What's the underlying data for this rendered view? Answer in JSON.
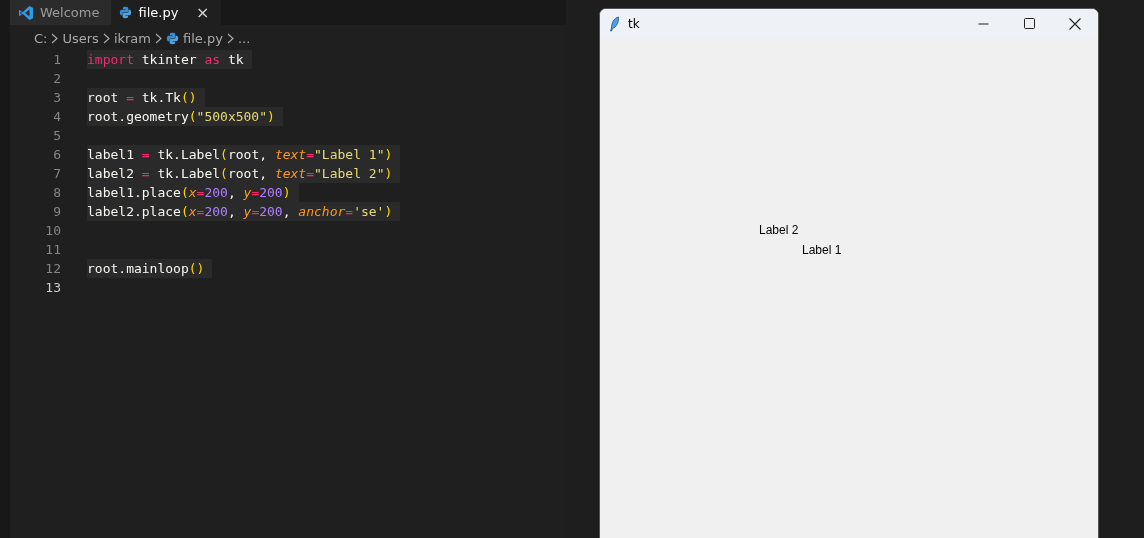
{
  "tabs": [
    {
      "label": "Welcome",
      "kind": "welcome",
      "selected": false
    },
    {
      "label": "file.py",
      "kind": "file",
      "selected": true,
      "close_glyph": "×"
    }
  ],
  "breadcrumb": [
    {
      "label": "C:",
      "kind": "folder"
    },
    {
      "label": "Users",
      "kind": "folder"
    },
    {
      "label": "ikram",
      "kind": "folder"
    },
    {
      "label": "file.py",
      "kind": "file"
    },
    {
      "label": "...",
      "kind": "more"
    }
  ],
  "code": [
    {
      "number": "1",
      "tokens": [
        {
          "kind": "keyword",
          "text": "import"
        },
        {
          "kind": "plain",
          "text": " tkinter "
        },
        {
          "kind": "keyword",
          "text": "as"
        },
        {
          "kind": "plain",
          "text": " tk"
        }
      ]
    },
    {
      "number": "2"
    },
    {
      "number": "3",
      "tokens": [
        {
          "kind": "plain",
          "text": "root "
        },
        {
          "kind": "operator",
          "text": "="
        },
        {
          "kind": "plain",
          "text": " tk.Tk"
        },
        {
          "kind": "paren",
          "text": "()"
        }
      ]
    },
    {
      "number": "4",
      "tokens": [
        {
          "kind": "plain",
          "text": "root.geometry"
        },
        {
          "kind": "paren",
          "text": "("
        },
        {
          "kind": "string",
          "text": "\"500x500\""
        },
        {
          "kind": "paren",
          "text": ")"
        }
      ]
    },
    {
      "number": "5"
    },
    {
      "number": "6",
      "tokens": [
        {
          "kind": "plain",
          "text": "label1 "
        },
        {
          "kind": "operator",
          "text": "="
        },
        {
          "kind": "plain",
          "text": " tk.Label"
        },
        {
          "kind": "paren",
          "text": "("
        },
        {
          "kind": "plain",
          "text": "root, "
        },
        {
          "kind": "param",
          "text": "text"
        },
        {
          "kind": "operator",
          "text": "="
        },
        {
          "kind": "string",
          "text": "\"Label 1\""
        },
        {
          "kind": "paren",
          "text": ")"
        }
      ]
    },
    {
      "number": "7",
      "tokens": [
        {
          "kind": "plain",
          "text": "label2 "
        },
        {
          "kind": "operator",
          "text": "="
        },
        {
          "kind": "plain",
          "text": " tk.Label"
        },
        {
          "kind": "paren",
          "text": "("
        },
        {
          "kind": "plain",
          "text": "root, "
        },
        {
          "kind": "param",
          "text": "text"
        },
        {
          "kind": "operator",
          "text": "="
        },
        {
          "kind": "string",
          "text": "\"Label 2\""
        },
        {
          "kind": "paren",
          "text": ")"
        }
      ]
    },
    {
      "number": "8",
      "tokens": [
        {
          "kind": "plain",
          "text": "label1.place"
        },
        {
          "kind": "paren",
          "text": "("
        },
        {
          "kind": "param",
          "text": "x"
        },
        {
          "kind": "operator",
          "text": "="
        },
        {
          "kind": "number",
          "text": "200"
        },
        {
          "kind": "plain",
          "text": ", "
        },
        {
          "kind": "param",
          "text": "y"
        },
        {
          "kind": "operator",
          "text": "="
        },
        {
          "kind": "number",
          "text": "200"
        },
        {
          "kind": "paren",
          "text": ")"
        }
      ]
    },
    {
      "number": "9",
      "tokens": [
        {
          "kind": "plain",
          "text": "label2.place"
        },
        {
          "kind": "paren",
          "text": "("
        },
        {
          "kind": "param",
          "text": "x"
        },
        {
          "kind": "operator",
          "text": "="
        },
        {
          "kind": "number",
          "text": "200"
        },
        {
          "kind": "plain",
          "text": ", "
        },
        {
          "kind": "param",
          "text": "y"
        },
        {
          "kind": "operator",
          "text": "="
        },
        {
          "kind": "number",
          "text": "200"
        },
        {
          "kind": "plain",
          "text": ", "
        },
        {
          "kind": "param",
          "text": "anchor"
        },
        {
          "kind": "operator",
          "text": "="
        },
        {
          "kind": "string",
          "text": "'se'"
        },
        {
          "kind": "paren",
          "text": ")"
        }
      ]
    },
    {
      "number": "10"
    },
    {
      "number": "11"
    },
    {
      "number": "12",
      "tokens": [
        {
          "kind": "plain",
          "text": "root.mainloop"
        },
        {
          "kind": "paren",
          "text": "()"
        }
      ]
    },
    {
      "number": "13"
    }
  ],
  "tk_window": {
    "title": "tk",
    "labels": [
      "Label 2",
      "Label 1"
    ]
  }
}
